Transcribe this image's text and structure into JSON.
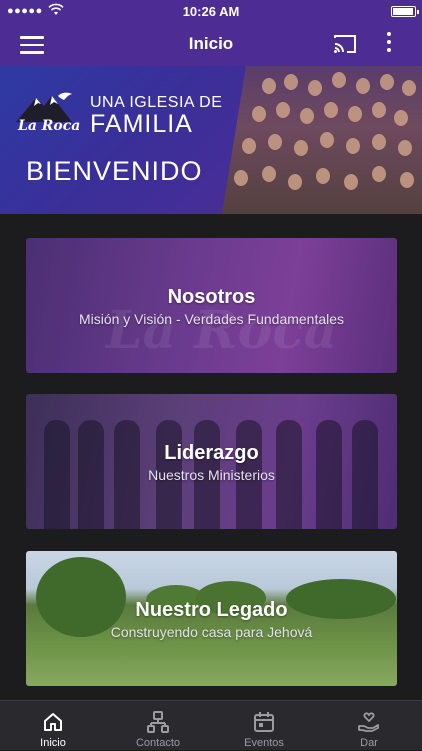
{
  "status_bar": {
    "time": "10:26 AM",
    "signal_dots": "●●●●●"
  },
  "app_bar": {
    "title": "Inicio"
  },
  "hero": {
    "logo_text": "La Roca",
    "tagline_line1": "UNA IGLESIA DE",
    "tagline_line2": "FAMILIA",
    "welcome": "BIENVENIDO"
  },
  "cards": [
    {
      "title": "Nosotros",
      "subtitle": "Misión y Visión - Verdades Fundamentales",
      "watermark": "La Roca"
    },
    {
      "title": "Liderazgo",
      "subtitle": "Nuestros Ministerios"
    },
    {
      "title": "Nuestro Legado",
      "subtitle": "Construyendo casa para Jehová"
    }
  ],
  "tabs": [
    {
      "label": "Inicio",
      "icon": "home-icon",
      "active": true
    },
    {
      "label": "Contacto",
      "icon": "contact-icon",
      "active": false
    },
    {
      "label": "Eventos",
      "icon": "calendar-icon",
      "active": false
    },
    {
      "label": "Dar",
      "icon": "give-icon",
      "active": false
    }
  ],
  "colors": {
    "brand": "#4d2c93",
    "background": "#1c1c1f",
    "tabbar": "#2a2a2e"
  }
}
